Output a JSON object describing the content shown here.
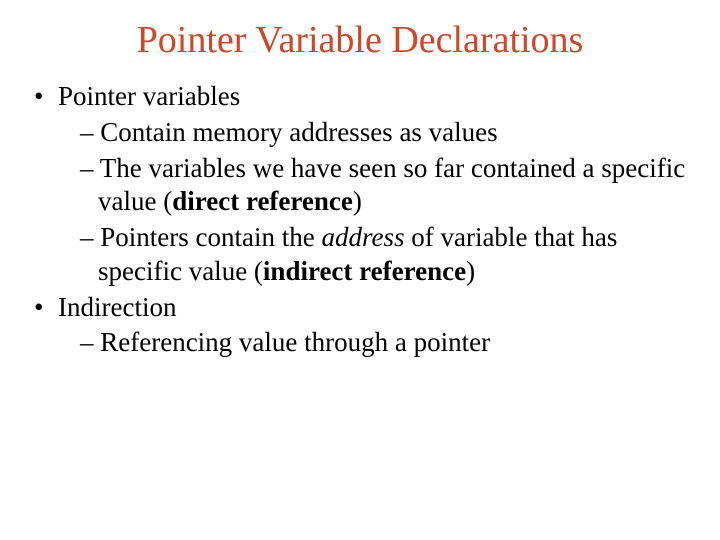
{
  "colors": {
    "title": "#c84a28"
  },
  "title": "Pointer Variable Declarations",
  "b1": "Pointer variables",
  "b1s1_dash": "– ",
  "b1s1": "Contain memory addresses as values",
  "b1s2_dash": "– ",
  "b1s2a": " The variables we have seen so far contained a specific value (",
  "b1s2b": "direct reference",
  "b1s2c": ")",
  "b1s3_dash": "– ",
  "b1s3a": "Pointers contain the ",
  "b1s3b": "address",
  "b1s3c": " of variable that has specific value (",
  "b1s3d": "indirect reference",
  "b1s3e": ")",
  "b2": "Indirection",
  "b2s1_dash": "– ",
  "b2s1": "Referencing value through a pointer"
}
